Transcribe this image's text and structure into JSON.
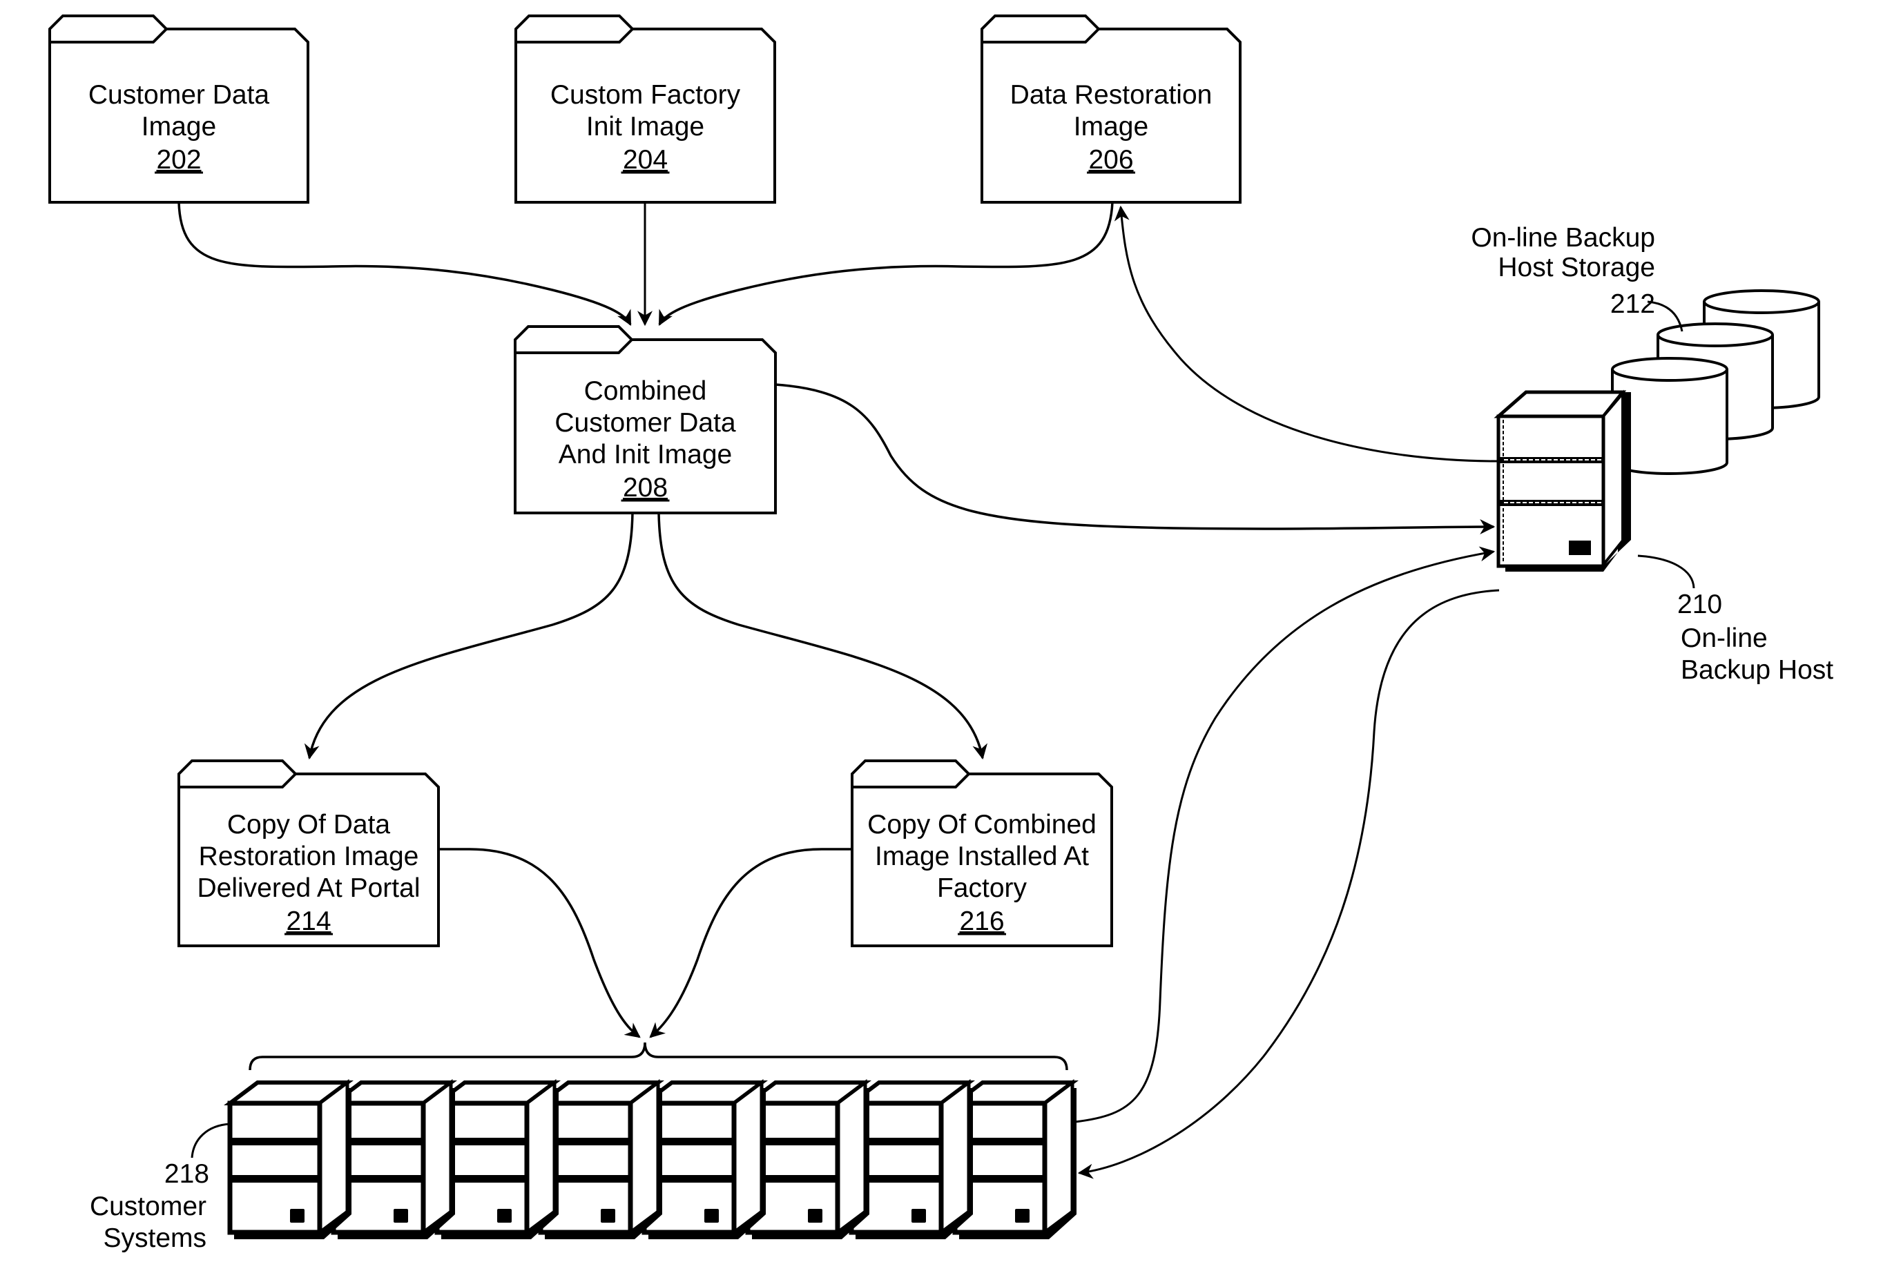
{
  "diagram": {
    "colors": {
      "ink": "#000000",
      "paper": "#ffffff"
    },
    "folders": [
      {
        "id": "202",
        "lines": [
          "Customer Data",
          "Image"
        ],
        "ref": "202"
      },
      {
        "id": "204",
        "lines": [
          "Custom Factory",
          "Init Image"
        ],
        "ref": "204"
      },
      {
        "id": "206",
        "lines": [
          "Data Restoration",
          "Image"
        ],
        "ref": "206"
      },
      {
        "id": "208",
        "lines": [
          "Combined",
          "Customer Data",
          "And Init Image"
        ],
        "ref": "208"
      },
      {
        "id": "214",
        "lines": [
          "Copy Of Data",
          "Restoration Image",
          "Delivered At Portal"
        ],
        "ref": "214"
      },
      {
        "id": "216",
        "lines": [
          "Copy Of Combined",
          "Image Installed At",
          "Factory"
        ],
        "ref": "216"
      }
    ],
    "storage_label": {
      "lines": [
        "On-line Backup",
        "Host Storage"
      ],
      "ref": "212"
    },
    "host_label": {
      "ref": "210",
      "lines": [
        "On-line",
        "Backup Host"
      ]
    },
    "customer_systems_label": {
      "ref": "218",
      "lines": [
        "Customer",
        "Systems"
      ]
    },
    "customer_system_count": 8,
    "storage_cylinder_count": 3,
    "connections": [
      {
        "from": "202",
        "to": "208"
      },
      {
        "from": "204",
        "to": "208"
      },
      {
        "from": "206",
        "to": "208"
      },
      {
        "from": "210",
        "to": "206"
      },
      {
        "from": "208",
        "to": "210"
      },
      {
        "from": "208",
        "to": "214"
      },
      {
        "from": "208",
        "to": "216"
      },
      {
        "from": "214",
        "to": "218"
      },
      {
        "from": "216",
        "to": "218"
      },
      {
        "from": "218",
        "to": "210"
      },
      {
        "from": "210",
        "to": "218"
      }
    ]
  }
}
